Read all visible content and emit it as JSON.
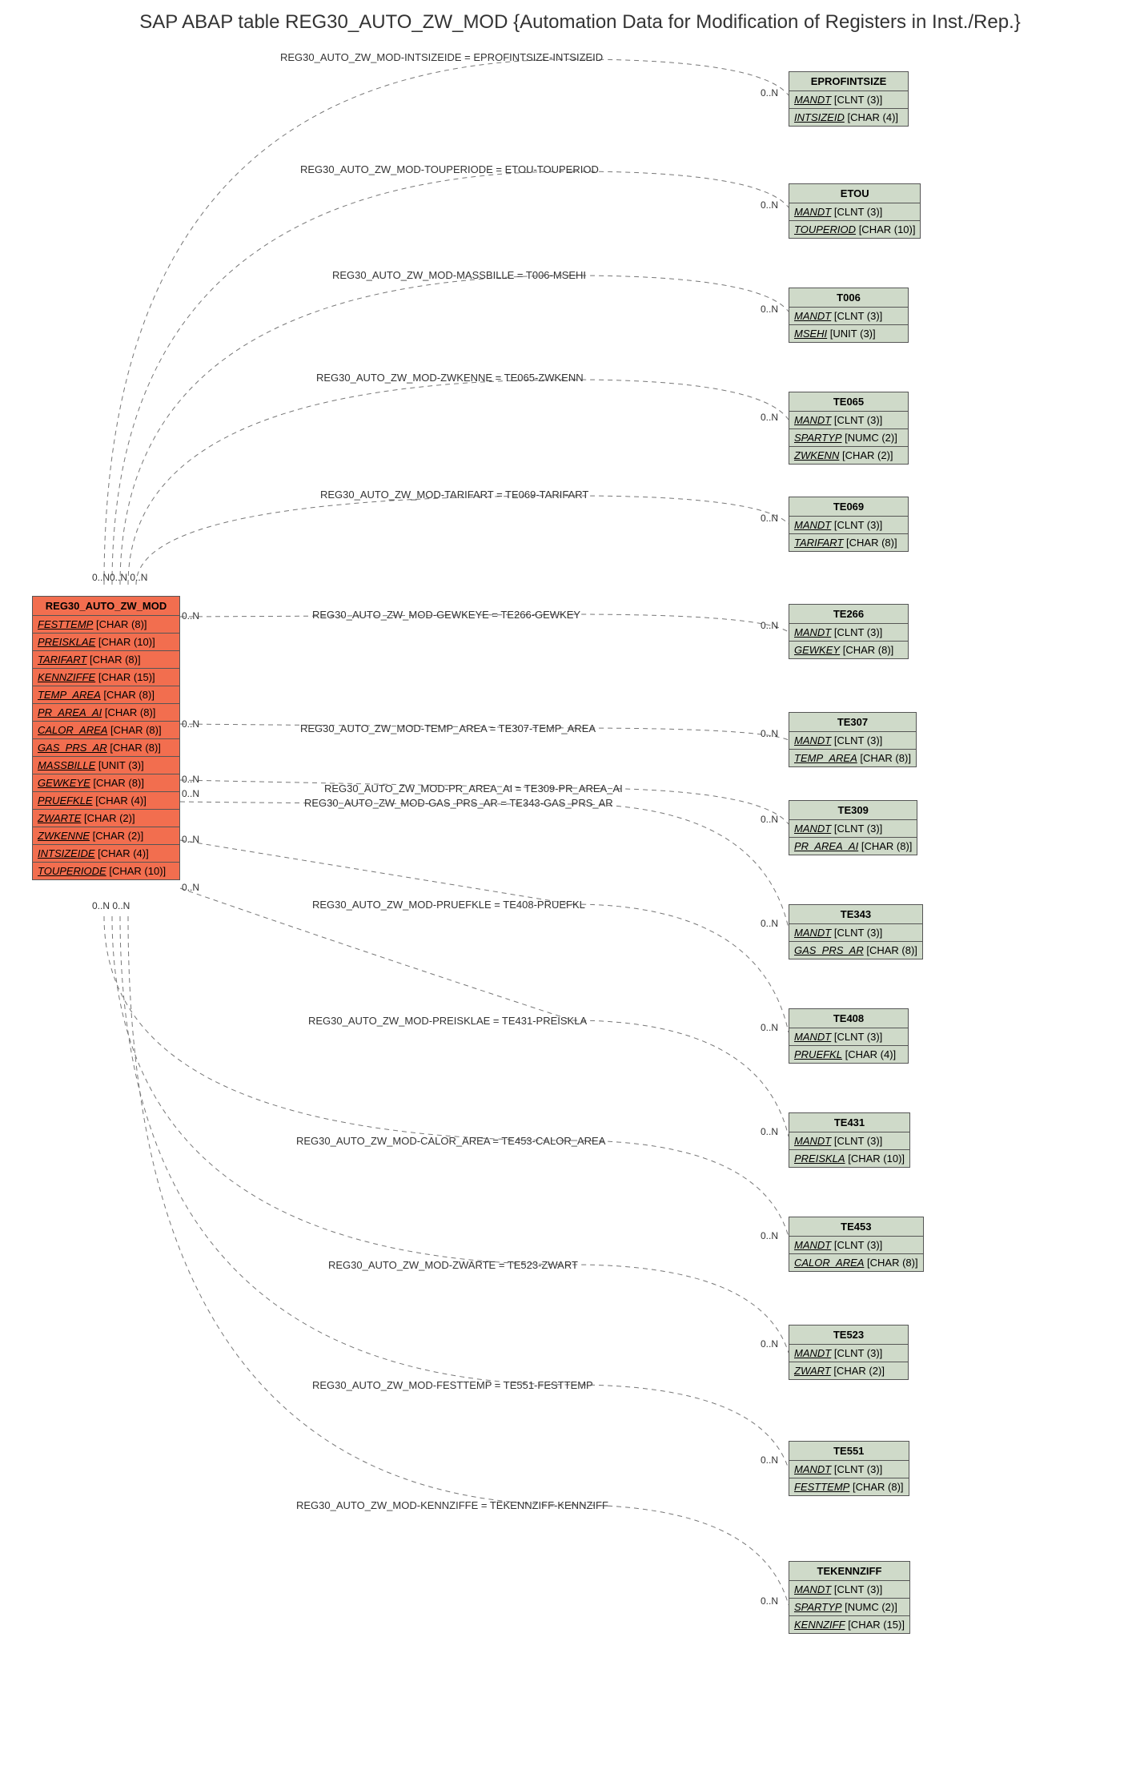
{
  "title": "SAP ABAP table REG30_AUTO_ZW_MOD {Automation Data for Modification of Registers in Inst./Rep.}",
  "source": {
    "name": "REG30_AUTO_ZW_MOD",
    "fields": [
      {
        "n": "FESTTEMP",
        "t": "[CHAR (8)]"
      },
      {
        "n": "PREISKLAE",
        "t": "[CHAR (10)]"
      },
      {
        "n": "TARIFART",
        "t": "[CHAR (8)]"
      },
      {
        "n": "KENNZIFFE",
        "t": "[CHAR (15)]"
      },
      {
        "n": "TEMP_AREA",
        "t": "[CHAR (8)]"
      },
      {
        "n": "PR_AREA_AI",
        "t": "[CHAR (8)]"
      },
      {
        "n": "CALOR_AREA",
        "t": "[CHAR (8)]"
      },
      {
        "n": "GAS_PRS_AR",
        "t": "[CHAR (8)]"
      },
      {
        "n": "MASSBILLE",
        "t": "[UNIT (3)]"
      },
      {
        "n": "GEWKEYE",
        "t": "[CHAR (8)]"
      },
      {
        "n": "PRUEFKLE",
        "t": "[CHAR (4)]"
      },
      {
        "n": "ZWARTE",
        "t": "[CHAR (2)]"
      },
      {
        "n": "ZWKENNE",
        "t": "[CHAR (2)]"
      },
      {
        "n": "INTSIZEIDE",
        "t": "[CHAR (4)]"
      },
      {
        "n": "TOUPERIODE",
        "t": "[CHAR (10)]"
      }
    ]
  },
  "targets": [
    {
      "name": "EPROFINTSIZE",
      "fields": [
        {
          "n": "MANDT",
          "t": "[CLNT (3)]"
        },
        {
          "n": "INTSIZEID",
          "t": "[CHAR (4)]"
        }
      ],
      "rel": "REG30_AUTO_ZW_MOD-INTSIZEIDE = EPROFINTSIZE-INTSIZEID"
    },
    {
      "name": "ETOU",
      "fields": [
        {
          "n": "MANDT",
          "t": "[CLNT (3)]"
        },
        {
          "n": "TOUPERIOD",
          "t": "[CHAR (10)]"
        }
      ],
      "rel": "REG30_AUTO_ZW_MOD-TOUPERIODE = ETOU-TOUPERIOD"
    },
    {
      "name": "T006",
      "fields": [
        {
          "n": "MANDT",
          "t": "[CLNT (3)]"
        },
        {
          "n": "MSEHI",
          "t": "[UNIT (3)]"
        }
      ],
      "rel": "REG30_AUTO_ZW_MOD-MASSBILLE = T006-MSEHI"
    },
    {
      "name": "TE065",
      "fields": [
        {
          "n": "MANDT",
          "t": "[CLNT (3)]"
        },
        {
          "n": "SPARTYP",
          "t": "[NUMC (2)]"
        },
        {
          "n": "ZWKENN",
          "t": "[CHAR (2)]"
        }
      ],
      "rel": "REG30_AUTO_ZW_MOD-ZWKENNE = TE065-ZWKENN"
    },
    {
      "name": "TE069",
      "fields": [
        {
          "n": "MANDT",
          "t": "[CLNT (3)]"
        },
        {
          "n": "TARIFART",
          "t": "[CHAR (8)]"
        }
      ],
      "rel": "REG30_AUTO_ZW_MOD-TARIFART = TE069-TARIFART"
    },
    {
      "name": "TE266",
      "fields": [
        {
          "n": "MANDT",
          "t": "[CLNT (3)]"
        },
        {
          "n": "GEWKEY",
          "t": "[CHAR (8)]"
        }
      ],
      "rel": "REG30_AUTO_ZW_MOD-GEWKEYE = TE266-GEWKEY"
    },
    {
      "name": "TE307",
      "fields": [
        {
          "n": "MANDT",
          "t": "[CLNT (3)]"
        },
        {
          "n": "TEMP_AREA",
          "t": "[CHAR (8)]"
        }
      ],
      "rel": "REG30_AUTO_ZW_MOD-TEMP_AREA = TE307-TEMP_AREA"
    },
    {
      "name": "TE309",
      "fields": [
        {
          "n": "MANDT",
          "t": "[CLNT (3)]"
        },
        {
          "n": "PR_AREA_AI",
          "t": "[CHAR (8)]"
        }
      ],
      "rel": "REG30_AUTO_ZW_MOD-PR_AREA_AI = TE309-PR_AREA_AI"
    },
    {
      "name": "TE343",
      "fields": [
        {
          "n": "MANDT",
          "t": "[CLNT (3)]"
        },
        {
          "n": "GAS_PRS_AR",
          "t": "[CHAR (8)]"
        }
      ],
      "rel": "REG30_AUTO_ZW_MOD-GAS_PRS_AR = TE343-GAS_PRS_AR"
    },
    {
      "name": "TE408",
      "fields": [
        {
          "n": "MANDT",
          "t": "[CLNT (3)]"
        },
        {
          "n": "PRUEFKL",
          "t": "[CHAR (4)]"
        }
      ],
      "rel": "REG30_AUTO_ZW_MOD-PRUEFKLE = TE408-PRUEFKL"
    },
    {
      "name": "TE431",
      "fields": [
        {
          "n": "MANDT",
          "t": "[CLNT (3)]"
        },
        {
          "n": "PREISKLA",
          "t": "[CHAR (10)]"
        }
      ],
      "rel": "REG30_AUTO_ZW_MOD-PREISKLAE = TE431-PREISKLA"
    },
    {
      "name": "TE453",
      "fields": [
        {
          "n": "MANDT",
          "t": "[CLNT (3)]"
        },
        {
          "n": "CALOR_AREA",
          "t": "[CHAR (8)]"
        }
      ],
      "rel": "REG30_AUTO_ZW_MOD-CALOR_AREA = TE453-CALOR_AREA"
    },
    {
      "name": "TE523",
      "fields": [
        {
          "n": "MANDT",
          "t": "[CLNT (3)]"
        },
        {
          "n": "ZWART",
          "t": "[CHAR (2)]"
        }
      ],
      "rel": "REG30_AUTO_ZW_MOD-ZWARTE = TE523-ZWART"
    },
    {
      "name": "TE551",
      "fields": [
        {
          "n": "MANDT",
          "t": "[CLNT (3)]"
        },
        {
          "n": "FESTTEMP",
          "t": "[CHAR (8)]"
        }
      ],
      "rel": "REG30_AUTO_ZW_MOD-FESTTEMP = TE551-FESTTEMP"
    },
    {
      "name": "TEKENNZIFF",
      "fields": [
        {
          "n": "MANDT",
          "t": "[CLNT (3)]"
        },
        {
          "n": "SPARTYP",
          "t": "[NUMC (2)]"
        },
        {
          "n": "KENNZIFF",
          "t": "[CHAR (15)]"
        }
      ],
      "rel": "REG30_AUTO_ZW_MOD-KENNZIFFE = TEKENNZIFF-KENNZIFF"
    }
  ],
  "cardinality_left": "0..N",
  "cardinality_right": "0..N",
  "top_cards_cluster": "0..N0..N 0..N",
  "bot_cards_cluster": "0..N 0..N"
}
